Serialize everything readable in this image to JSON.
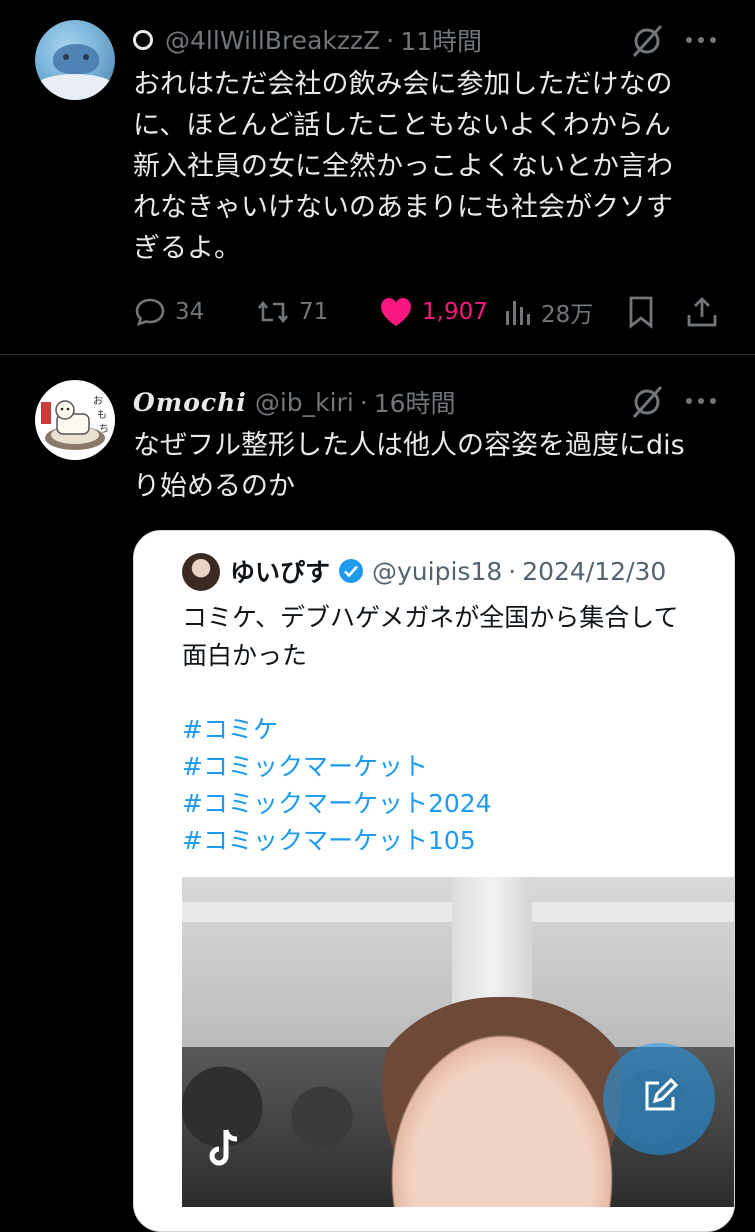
{
  "posts": [
    {
      "handle": "@4llWillBreakzzZ",
      "time": "11時間",
      "text": "おれはただ会社の飲み会に参加しただけなの\nに、ほとんど話したこともないよくわからん\n新入社員の女に全然かっこよくないとか言わ\nれなきゃいけないのあまりにも社会がクソす\nぎるよ。",
      "stats": {
        "replies": "34",
        "reposts": "71",
        "likes": "1,907",
        "views": "28万"
      },
      "colors": {
        "like": "#f91880",
        "muted": "#71767b"
      }
    },
    {
      "display_name": "Omochi",
      "handle": "@ib_kiri",
      "time": "16時間",
      "text": "なぜフル整形した人は他人の容姿を過度にdis\nり始めるのか",
      "quote": {
        "name": "ゆいぴす",
        "handle": "@yuipis18",
        "date": "2024/12/30",
        "text": "コミケ、デブハゲメガネが全国から集合して\n面白かった",
        "hashtags": [
          "#コミケ",
          "#コミックマーケット",
          "#コミックマーケット2024",
          "#コミックマーケット105"
        ],
        "colors": {
          "hashtag": "#1d9bf0",
          "verified": "#1d9bf0"
        }
      }
    }
  ],
  "sep": "·",
  "icons": [
    "grok-icon",
    "more-icon",
    "reply-icon",
    "repost-icon",
    "heart-icon",
    "views-icon",
    "bookmark-icon",
    "share-icon",
    "compose-icon",
    "tiktok-logo"
  ],
  "fab_color": "#1d9bf0"
}
